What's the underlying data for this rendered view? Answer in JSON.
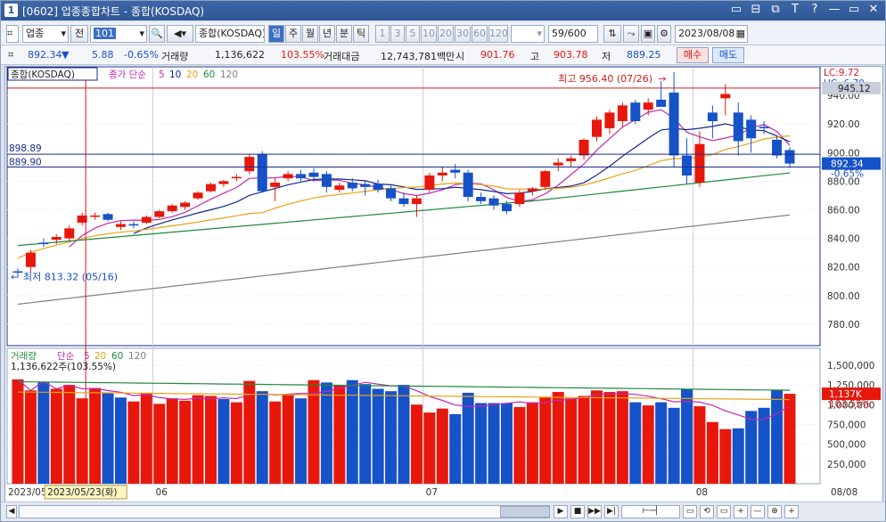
{
  "window": {
    "title": "[0602] 업종종합차트 - 종합(KOSDAQ)",
    "icon_label": "1",
    "title_buttons": [
      "▭",
      "⊟",
      "⧉",
      "T",
      "?",
      "—",
      "▭",
      "✕"
    ]
  },
  "toolbar": {
    "market_select": "업종",
    "prev_button": "전",
    "code_value": "101",
    "name_value": "종합(KOSDAQ)",
    "periods": [
      {
        "label": "일",
        "selected": true
      },
      {
        "label": "주",
        "selected": false
      },
      {
        "label": "월",
        "selected": false
      },
      {
        "label": "년",
        "selected": false
      },
      {
        "label": "분",
        "selected": false
      },
      {
        "label": "틱",
        "selected": false
      }
    ],
    "intervals": [
      "1",
      "3",
      "5",
      "10",
      "20",
      "30",
      "60",
      "120"
    ],
    "count": "59",
    "count_max": "/600",
    "date": "2023/08/08"
  },
  "quote": {
    "price": "892.34",
    "change_arrow": "▼",
    "change": "5.88",
    "change_pct": "-0.65%",
    "volume_label": "거래량",
    "volume": "1,136,622",
    "volume_ratio": "103.55%",
    "amount_label": "거래대금",
    "amount": "12,743,781백만",
    "open_label": "시",
    "open": "901.76",
    "high_label": "고",
    "high": "903.78",
    "low_label": "저",
    "low": "889.25",
    "buy_button": "매수",
    "sell_button": "매도"
  },
  "price_panel": {
    "title": "종합(KOSDAQ)",
    "ma_label": "종가 단순",
    "ma_periods": [
      "5",
      "10",
      "20",
      "60",
      "120"
    ],
    "lc_label": "LC:9.72",
    "hc_label": "HC:-6.70",
    "high_annotation": "최고 956.40 (07/26)",
    "low_annotation": "최저 813.32 (05/16)",
    "hline_upper_label": "898.89",
    "hline_lower_label": "889.90",
    "current_price_tag": "892.34",
    "current_change_tag": "-0.65%",
    "upper_tag": "945.12"
  },
  "volume_panel": {
    "title": "거래량",
    "ma_label": "단순",
    "ma_periods": [
      "5",
      "20",
      "60",
      "120"
    ],
    "current_label": "1,136,622주(103.55%)",
    "current_tag": "1,137K",
    "ratio_tag": "103.55%"
  },
  "x_axis": {
    "start_label": "2023/05",
    "crosshair_label": "2023/05/23(화)",
    "month_labels": [
      "06",
      "07",
      "08"
    ],
    "end_label": "08/08"
  },
  "colors": {
    "up": "#e8170c",
    "down": "#1652c8",
    "ma5": "#c02ab0",
    "ma10": "#14288e",
    "ma20": "#e8a214",
    "ma60": "#1f8a3c",
    "ma120": "#808080"
  },
  "chart_data": {
    "type": "candlestick",
    "title": "종합(KOSDAQ)",
    "price_axis": {
      "ticks": [
        780,
        800,
        820,
        840,
        860,
        880,
        900,
        920,
        940
      ],
      "range": [
        765,
        960
      ]
    },
    "volume_axis": {
      "ticks": [
        "250,000",
        "500,000",
        "750,000",
        "1,000,000",
        "1,250,000",
        "1,500,000"
      ],
      "range": [
        0,
        1600000
      ]
    },
    "candles": [
      {
        "o": 817,
        "h": 819,
        "l": 813.32,
        "c": 816
      },
      {
        "o": 820,
        "h": 832,
        "l": 816,
        "c": 830
      },
      {
        "o": 837,
        "h": 840,
        "l": 834,
        "c": 836
      },
      {
        "o": 839,
        "h": 843,
        "l": 836,
        "c": 841
      },
      {
        "o": 840,
        "h": 849,
        "l": 838,
        "c": 847
      },
      {
        "o": 851,
        "h": 858,
        "l": 849,
        "c": 856
      },
      {
        "o": 856,
        "h": 858,
        "l": 853,
        "c": 856
      },
      {
        "o": 857,
        "h": 858,
        "l": 852,
        "c": 853
      },
      {
        "o": 848,
        "h": 852,
        "l": 846,
        "c": 850
      },
      {
        "o": 850,
        "h": 852,
        "l": 847,
        "c": 849
      },
      {
        "o": 851,
        "h": 856,
        "l": 850,
        "c": 855
      },
      {
        "o": 855,
        "h": 860,
        "l": 854,
        "c": 859
      },
      {
        "o": 859,
        "h": 864,
        "l": 858,
        "c": 863
      },
      {
        "o": 862,
        "h": 866,
        "l": 860,
        "c": 865
      },
      {
        "o": 868,
        "h": 873,
        "l": 867,
        "c": 872
      },
      {
        "o": 873,
        "h": 879,
        "l": 872,
        "c": 878
      },
      {
        "o": 878,
        "h": 881,
        "l": 876,
        "c": 880
      },
      {
        "o": 882,
        "h": 885,
        "l": 880,
        "c": 883
      },
      {
        "o": 887,
        "h": 899,
        "l": 885,
        "c": 897
      },
      {
        "o": 899,
        "h": 901,
        "l": 872,
        "c": 873
      },
      {
        "o": 876,
        "h": 882,
        "l": 866,
        "c": 879
      },
      {
        "o": 882,
        "h": 887,
        "l": 880,
        "c": 885
      },
      {
        "o": 885,
        "h": 888,
        "l": 880,
        "c": 882
      },
      {
        "o": 886,
        "h": 889,
        "l": 880,
        "c": 883
      },
      {
        "o": 885,
        "h": 887,
        "l": 872,
        "c": 876
      },
      {
        "o": 874,
        "h": 879,
        "l": 872,
        "c": 877
      },
      {
        "o": 879,
        "h": 882,
        "l": 873,
        "c": 875
      },
      {
        "o": 878,
        "h": 880,
        "l": 870,
        "c": 876
      },
      {
        "o": 878,
        "h": 881,
        "l": 872,
        "c": 874
      },
      {
        "o": 875,
        "h": 877,
        "l": 866,
        "c": 868
      },
      {
        "o": 868,
        "h": 872,
        "l": 862,
        "c": 864
      },
      {
        "o": 864,
        "h": 870,
        "l": 855,
        "c": 868
      },
      {
        "o": 874,
        "h": 886,
        "l": 872,
        "c": 884
      },
      {
        "o": 884,
        "h": 890,
        "l": 880,
        "c": 886
      },
      {
        "o": 888,
        "h": 892,
        "l": 882,
        "c": 886
      },
      {
        "o": 886,
        "h": 888,
        "l": 866,
        "c": 869
      },
      {
        "o": 869,
        "h": 872,
        "l": 864,
        "c": 866
      },
      {
        "o": 868,
        "h": 870,
        "l": 860,
        "c": 863
      },
      {
        "o": 864,
        "h": 866,
        "l": 857,
        "c": 859
      },
      {
        "o": 864,
        "h": 874,
        "l": 862,
        "c": 872
      },
      {
        "o": 873,
        "h": 876,
        "l": 870,
        "c": 875
      },
      {
        "o": 876,
        "h": 888,
        "l": 874,
        "c": 887
      },
      {
        "o": 891,
        "h": 896,
        "l": 887,
        "c": 893
      },
      {
        "o": 894,
        "h": 898,
        "l": 890,
        "c": 896
      },
      {
        "o": 898,
        "h": 910,
        "l": 895,
        "c": 909
      },
      {
        "o": 911,
        "h": 925,
        "l": 908,
        "c": 923
      },
      {
        "o": 917,
        "h": 930,
        "l": 913,
        "c": 928
      },
      {
        "o": 922,
        "h": 935,
        "l": 918,
        "c": 933
      },
      {
        "o": 935,
        "h": 937,
        "l": 920,
        "c": 922
      },
      {
        "o": 930,
        "h": 938,
        "l": 926,
        "c": 935
      },
      {
        "o": 937,
        "h": 950,
        "l": 934,
        "c": 932
      },
      {
        "o": 942,
        "h": 956.4,
        "l": 890,
        "c": 898
      },
      {
        "o": 898,
        "h": 910,
        "l": 878,
        "c": 884
      },
      {
        "o": 879,
        "h": 915,
        "l": 876,
        "c": 906
      },
      {
        "o": 928,
        "h": 933,
        "l": 910,
        "c": 922
      },
      {
        "o": 938,
        "h": 948,
        "l": 926,
        "c": 941
      },
      {
        "o": 928,
        "h": 935,
        "l": 898,
        "c": 908
      },
      {
        "o": 923,
        "h": 926,
        "l": 900,
        "c": 910
      },
      {
        "o": 918,
        "h": 922,
        "l": 913,
        "c": 917
      },
      {
        "o": 909,
        "h": 912,
        "l": 896,
        "c": 898
      },
      {
        "o": 901.76,
        "h": 903.78,
        "l": 889.25,
        "c": 892.34
      }
    ],
    "volumes": [
      1320000,
      1180000,
      1290000,
      1200000,
      1250000,
      1080000,
      1210000,
      1150000,
      1090000,
      1040000,
      1150000,
      1010000,
      1080000,
      1050000,
      1120000,
      1110000,
      1070000,
      1030000,
      1300000,
      1170000,
      1040000,
      1120000,
      1080000,
      1310000,
      1280000,
      1250000,
      1310000,
      1260000,
      1200000,
      1170000,
      1250000,
      1000000,
      900000,
      950000,
      880000,
      1150000,
      1020000,
      1020000,
      1020000,
      970000,
      1030000,
      1090000,
      1160000,
      1080000,
      1110000,
      1180000,
      1160000,
      1170000,
      1030000,
      990000,
      1030000,
      960000,
      1200000,
      980000,
      780000,
      690000,
      700000,
      920000,
      960000,
      1180000,
      1137000
    ],
    "volume_up": [
      true,
      true,
      false,
      true,
      true,
      true,
      true,
      false,
      false,
      true,
      true,
      true,
      true,
      true,
      true,
      true,
      false,
      true,
      true,
      false,
      true,
      true,
      false,
      true,
      false,
      true,
      false,
      false,
      false,
      false,
      false,
      true,
      true,
      true,
      false,
      false,
      false,
      false,
      false,
      true,
      true,
      true,
      true,
      true,
      true,
      true,
      true,
      true,
      false,
      true,
      false,
      false,
      false,
      true,
      true,
      true,
      false,
      false,
      false,
      false,
      true
    ]
  }
}
